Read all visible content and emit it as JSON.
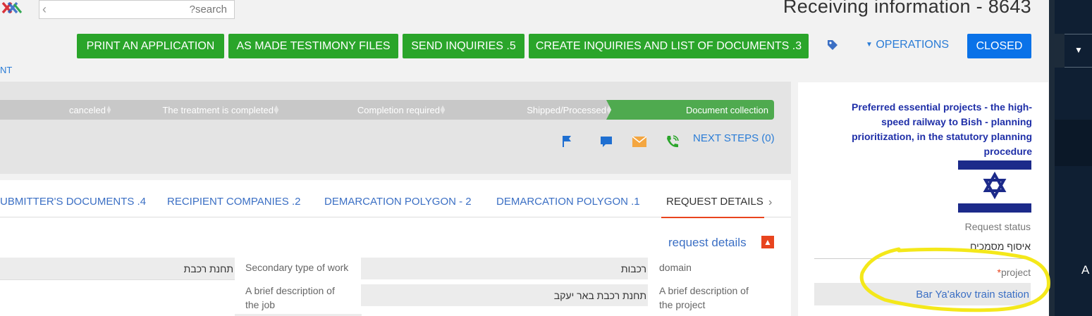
{
  "header": {
    "search_placeholder": "?search",
    "title": "Receiving information - 8643",
    "partial_link": "NT"
  },
  "toolbar": {
    "buttons": [
      {
        "label": "PRINT AN APPLICATION"
      },
      {
        "label": "AS MADE TESTIMONY FILES"
      },
      {
        "label": "SEND INQUIRIES .5"
      },
      {
        "label": "CREATE INQUIRIES AND LIST OF DOCUMENTS .3"
      }
    ],
    "operations_label": "OPERATIONS",
    "status_button": "CLOSED"
  },
  "process": {
    "stages": [
      {
        "label": "canceled",
        "state": "inactive"
      },
      {
        "label": "The treatment is completed",
        "state": "inactive"
      },
      {
        "label": "Completion required",
        "state": "inactive"
      },
      {
        "label": "Shipped/Processed",
        "state": "inactive"
      },
      {
        "label": "Document collection",
        "state": "active"
      }
    ],
    "next_steps_label": "NEXT STEPS (0)"
  },
  "tabs": [
    {
      "label": "UBMITTER'S DOCUMENTS .4"
    },
    {
      "label": "RECIPIENT COMPANIES .2"
    },
    {
      "label": "DEMARCATION POLYGON - 2"
    },
    {
      "label": "DEMARCATION POLYGON .1"
    },
    {
      "label": "REQUEST DETAILS",
      "active": true
    }
  ],
  "request_details": {
    "section_title": "request details",
    "fields": {
      "domain_label": "domain",
      "domain_value": "רכבות",
      "secondary_label": "Secondary type of work",
      "secondary_value": "תחנת רכבת",
      "brief_project_label": "A brief description of the project",
      "brief_project_value": "תחנת רכבת באר יעקב",
      "brief_job_label": "A brief description of the job"
    }
  },
  "info_card": {
    "project_title": "Preferred essential projects - the high-speed railway to Bish - planning prioritization, in the statutory planning procedure",
    "request_status_label": "Request status",
    "request_status_value": "איסוף מסמכים",
    "project_label": "project",
    "required_mark": "*",
    "project_value": "Bar Ya'akov train station"
  },
  "sidebar": {
    "partial_text": "A"
  },
  "colors": {
    "green_button": "#2aa52a",
    "blue_button": "#0a72e8",
    "active_stage": "#4faa4f",
    "inactive_stage": "#c8c8c8",
    "accent_orange": "#e8441e",
    "highlight_circle": "#f4e81a"
  }
}
